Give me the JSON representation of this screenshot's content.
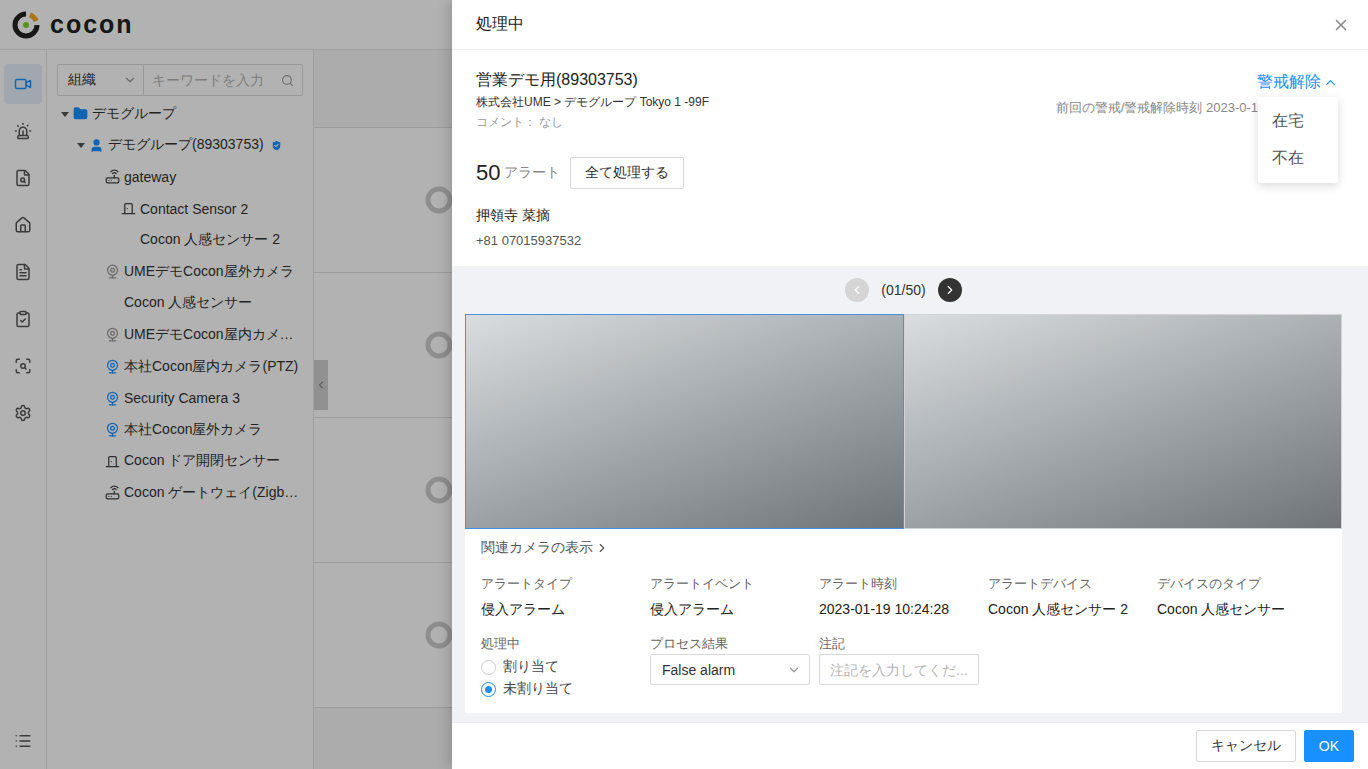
{
  "app": {
    "logo": "cocon"
  },
  "rail": [
    {
      "selected": true
    },
    {
      "selected": false
    },
    {
      "selected": false
    },
    {
      "selected": false
    },
    {
      "selected": false
    },
    {
      "selected": false
    },
    {
      "selected": false
    },
    {
      "selected": false
    },
    {
      "selected": false
    }
  ],
  "tree_filter": {
    "select": "組織",
    "placeholder": "キーワードを入力"
  },
  "tree": [
    {
      "label": "デモグループ",
      "level": 0,
      "kind": "folder",
      "expanded": true
    },
    {
      "label": "デモグループ(89303753)",
      "level": 1,
      "kind": "group",
      "expanded": true,
      "verified": true
    },
    {
      "label": "gateway",
      "level": 2,
      "kind": "gateway"
    },
    {
      "label": "Contact Sensor 2",
      "level": 3,
      "kind": "sensor"
    },
    {
      "label": "Cocon 人感センサー 2",
      "level": 3,
      "kind": "none"
    },
    {
      "label": "UMEデモCocon屋外カメラ",
      "level": 2,
      "kind": "camera",
      "online": false
    },
    {
      "label": "Cocon 人感センサー",
      "level": 2,
      "kind": "none"
    },
    {
      "label": "UMEデモCocon屋内カメ…",
      "level": 2,
      "kind": "camera",
      "online": false
    },
    {
      "label": "本社Cocon屋内カメラ(PTZ)",
      "level": 2,
      "kind": "camera",
      "online": true
    },
    {
      "label": "Security Camera 3",
      "level": 2,
      "kind": "camera",
      "online": true
    },
    {
      "label": "本社Cocon屋外カメラ",
      "level": 2,
      "kind": "camera",
      "online": true
    },
    {
      "label": "Cocon ドア開閉センサー",
      "level": 2,
      "kind": "sensor"
    },
    {
      "label": "Cocon ゲートウェイ(Zigb…",
      "level": 2,
      "kind": "gateway"
    }
  ],
  "drawer": {
    "title": "処理中"
  },
  "site": {
    "name": "営業デモ用(89303753)",
    "path": "株式会社UME > デモグループ Tokyo 1 -99F",
    "comment_label": "コメント：",
    "comment": "なし"
  },
  "arm": {
    "label": "警戒解除",
    "expanded": true,
    "last": "前回の警戒/警戒解除時刻 2023-0-1",
    "options": [
      {
        "label": "在宅",
        "selected": false
      },
      {
        "label": "不在",
        "selected": false
      }
    ]
  },
  "alerts": {
    "count": "50",
    "unit": "アラート",
    "button": "全て処理する"
  },
  "contact": {
    "name": "押領寺 菜摘",
    "phone": "+81 07015937532"
  },
  "pager": {
    "text": "(01/50)",
    "prev_disabled": true,
    "next_disabled": false
  },
  "snapshots": [
    {
      "selected": true
    },
    {
      "selected": false
    }
  ],
  "related_link": "関連カメラの表示",
  "details": [
    {
      "label": "アラートタイプ",
      "value": "侵入アラーム"
    },
    {
      "label": "アラートイベント",
      "value": "侵入アラーム"
    },
    {
      "label": "アラート時刻",
      "value": "2023-01-19 10:24:28"
    },
    {
      "label": "アラートデバイス",
      "value": "Cocon 人感センサー 2"
    },
    {
      "label": "デバイスのタイプ",
      "value": "Cocon 人感センサー"
    }
  ],
  "status": {
    "label": "処理中",
    "options": [
      {
        "label": "割り当て",
        "selected": false
      },
      {
        "label": "未割り当て",
        "selected": true
      }
    ]
  },
  "result": {
    "label": "プロセス結果",
    "value": "False alarm"
  },
  "note": {
    "label": "注記",
    "placeholder": "注記を入力してくだ..."
  },
  "footer": {
    "cancel": "キャンセル",
    "ok": "OK"
  }
}
